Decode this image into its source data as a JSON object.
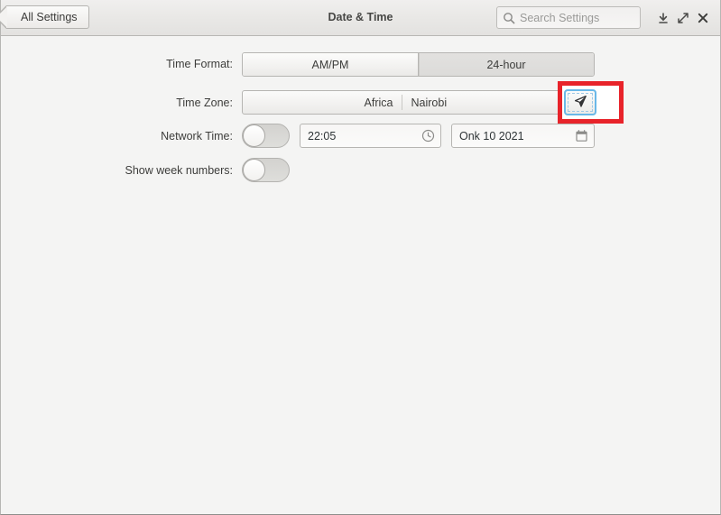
{
  "window": {
    "title": "Date & Time"
  },
  "header": {
    "back_label": "All Settings",
    "title": "Date & Time",
    "search": {
      "placeholder": "Search Settings",
      "value": "",
      "icon": "search-icon"
    },
    "buttons": [
      {
        "name": "minimize-button",
        "icon": "download-minimize-icon"
      },
      {
        "name": "maximize-button",
        "icon": "expand-arrows-icon"
      },
      {
        "name": "close-button",
        "icon": "close-x-icon"
      }
    ]
  },
  "settings": {
    "time_format": {
      "label": "Time Format:",
      "options": [
        {
          "label": "AM/PM",
          "selected": false
        },
        {
          "label": "24-hour",
          "selected": true
        }
      ]
    },
    "time_zone": {
      "label": "Time Zone:",
      "region": "Africa",
      "city": "Nairobi",
      "location_button": {
        "name": "detect-location-button",
        "icon": "navigation-arrow-icon",
        "focused": true,
        "highlighted": true
      }
    },
    "network_time": {
      "label": "Network Time:",
      "toggle": {
        "on": false
      },
      "time_value": "22:05",
      "time_icon": "clock-icon",
      "date_value": "Onk 10 2021",
      "date_icon": "calendar-icon"
    },
    "show_week_numbers": {
      "label": "Show week numbers:",
      "toggle": {
        "on": false
      }
    }
  },
  "colors": {
    "highlight": "#e8232a",
    "focus_ring": "#6ab8e8",
    "background": "#f4f4f3",
    "header_bg": "#e9e8e6",
    "text": "#2e3436"
  }
}
